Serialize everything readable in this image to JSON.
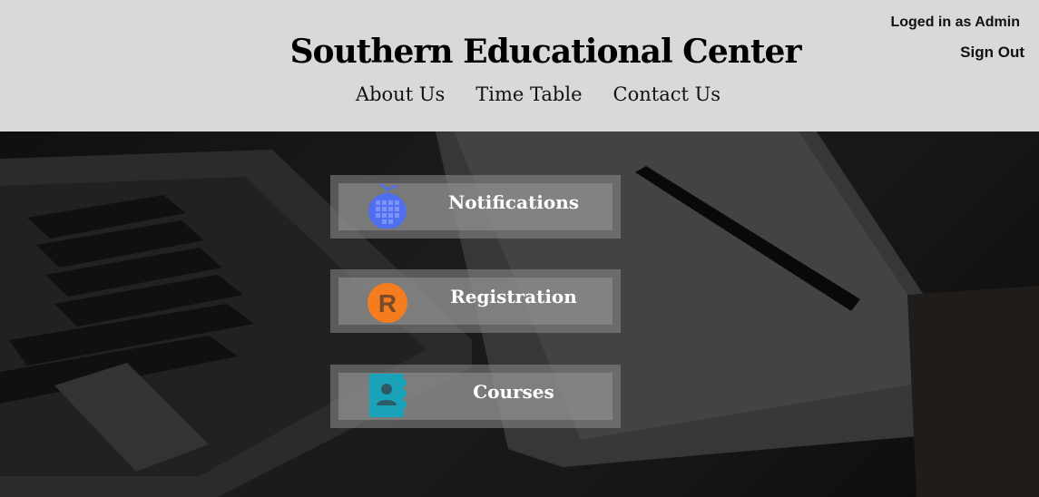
{
  "header": {
    "title": "Southern Educational Center",
    "nav": [
      "About Us",
      "Time Table",
      "Contact Us"
    ],
    "login_status": "Loged in as Admin",
    "sign_out": "Sign Out"
  },
  "menu": [
    {
      "label": "Notifications",
      "icon": "calendar-apple-icon",
      "color": "#4f6ff0"
    },
    {
      "label": "Registration",
      "icon": "registration-r-icon",
      "color": "#f57c1f"
    },
    {
      "label": "Courses",
      "icon": "contact-book-icon",
      "color": "#1aa2b8"
    }
  ],
  "colors": {
    "header_bg": "#d9d9d9",
    "hero_bg": "#1e1e1e"
  }
}
